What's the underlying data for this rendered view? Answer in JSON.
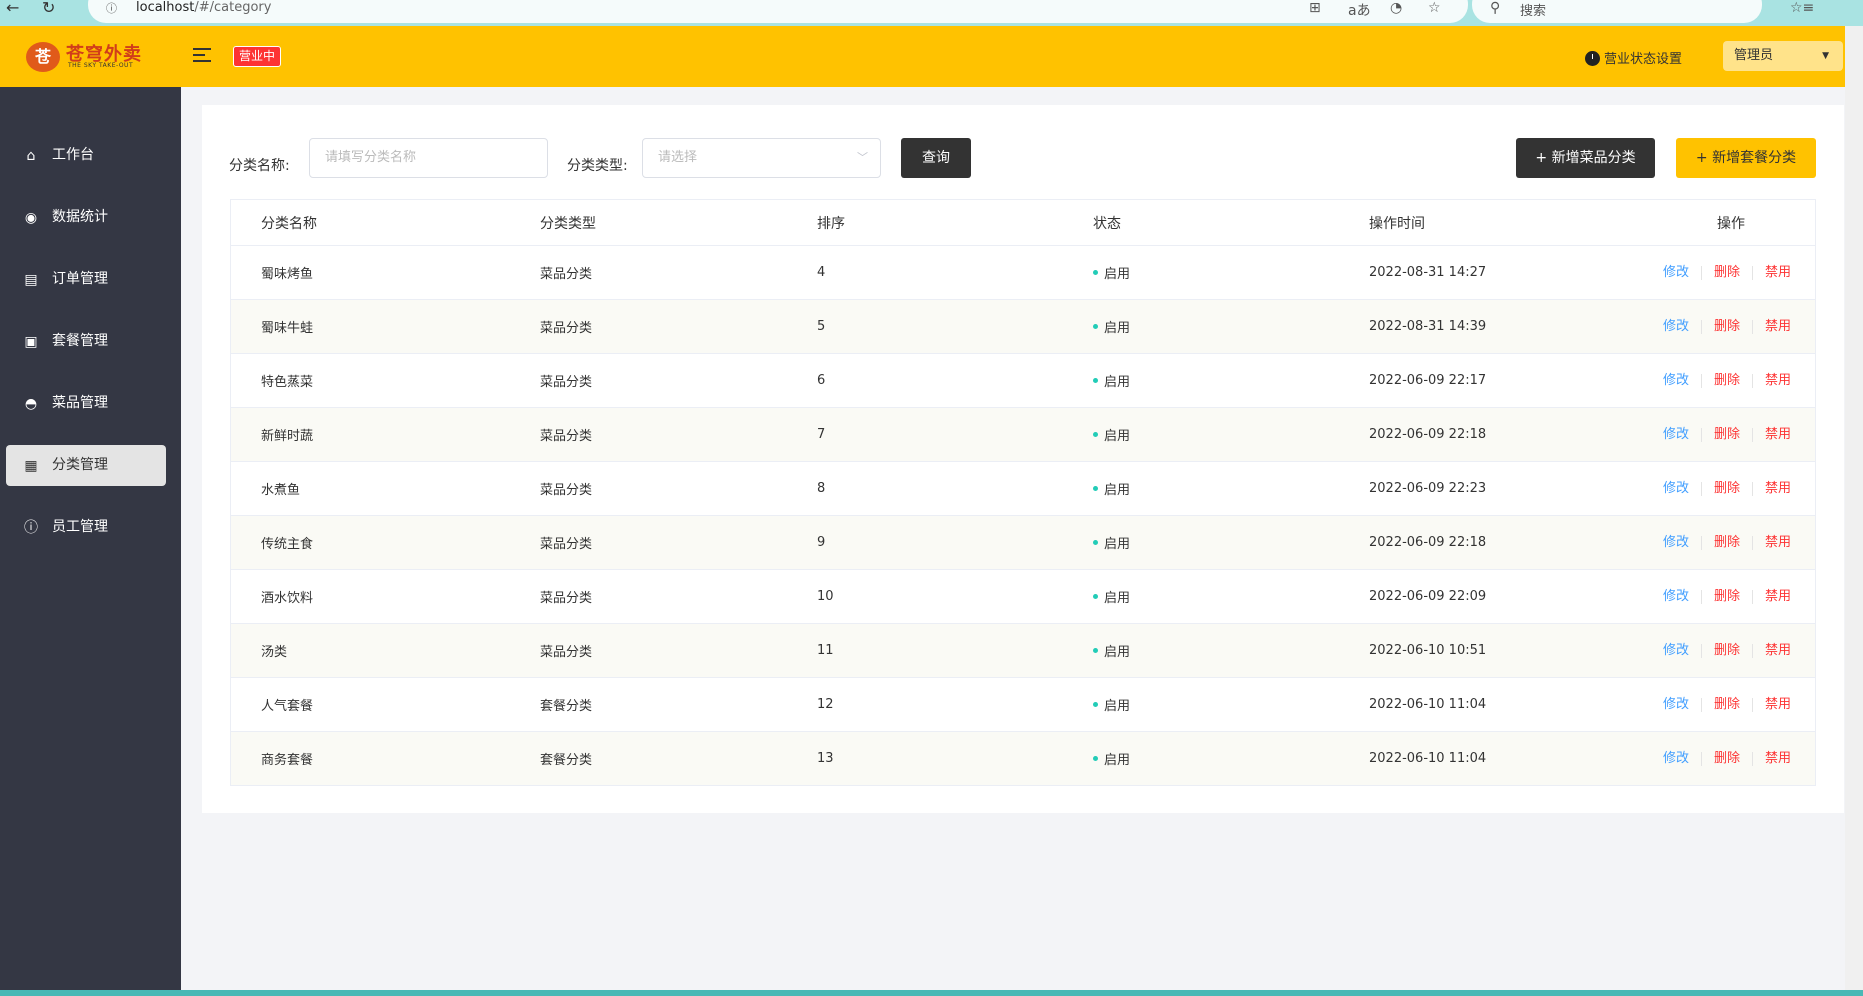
{
  "browser": {
    "url_host": "localhost",
    "url_path": "/#/category",
    "search_placeholder": "搜索"
  },
  "header": {
    "logo_name": "苍穹外卖",
    "logo_sub": "THE SKY TAKE-OUT",
    "business_badge": "营业中",
    "status_setting": "营业状态设置",
    "admin_label": "管理员"
  },
  "sidebar": {
    "items": [
      {
        "label": "工作台",
        "icon": "home-icon"
      },
      {
        "label": "数据统计",
        "icon": "chart-icon"
      },
      {
        "label": "订单管理",
        "icon": "clipboard-icon"
      },
      {
        "label": "套餐管理",
        "icon": "gift-icon"
      },
      {
        "label": "菜品管理",
        "icon": "dish-cover-icon"
      },
      {
        "label": "分类管理",
        "icon": "grid-icon"
      },
      {
        "label": "员工管理",
        "icon": "info-icon"
      }
    ],
    "active_index": 5
  },
  "filters": {
    "name_label": "分类名称:",
    "name_placeholder": "请填写分类名称",
    "type_label": "分类类型:",
    "type_placeholder": "请选择",
    "query_button": "查询",
    "add_dish_category": "+ 新增菜品分类",
    "add_set_category": "+ 新增套餐分类"
  },
  "table": {
    "headers": [
      "分类名称",
      "分类类型",
      "排序",
      "状态",
      "操作时间",
      "操作"
    ],
    "actions": {
      "edit": "修改",
      "delete": "删除",
      "disable": "禁用"
    },
    "rows": [
      {
        "name": "蜀味烤鱼",
        "type": "菜品分类",
        "sort": "4",
        "status": "启用",
        "time": "2022-08-31 14:27"
      },
      {
        "name": "蜀味牛蛙",
        "type": "菜品分类",
        "sort": "5",
        "status": "启用",
        "time": "2022-08-31 14:39"
      },
      {
        "name": "特色蒸菜",
        "type": "菜品分类",
        "sort": "6",
        "status": "启用",
        "time": "2022-06-09 22:17"
      },
      {
        "name": "新鲜时蔬",
        "type": "菜品分类",
        "sort": "7",
        "status": "启用",
        "time": "2022-06-09 22:18"
      },
      {
        "name": "水煮鱼",
        "type": "菜品分类",
        "sort": "8",
        "status": "启用",
        "time": "2022-06-09 22:23"
      },
      {
        "name": "传统主食",
        "type": "菜品分类",
        "sort": "9",
        "status": "启用",
        "time": "2022-06-09 22:18"
      },
      {
        "name": "酒水饮料",
        "type": "菜品分类",
        "sort": "10",
        "status": "启用",
        "time": "2022-06-09 22:09"
      },
      {
        "name": "汤类",
        "type": "菜品分类",
        "sort": "11",
        "status": "启用",
        "time": "2022-06-10 10:51"
      },
      {
        "name": "人气套餐",
        "type": "套餐分类",
        "sort": "12",
        "status": "启用",
        "time": "2022-06-10 11:04"
      },
      {
        "name": "商务套餐",
        "type": "套餐分类",
        "sort": "13",
        "status": "启用",
        "time": "2022-06-10 11:04"
      }
    ]
  },
  "colors": {
    "brand_yellow": "#ffc200",
    "sidebar_bg": "#343744",
    "status_dot": "#22ccb7",
    "edit_link": "#419eff",
    "danger_link": "#fd3333"
  }
}
